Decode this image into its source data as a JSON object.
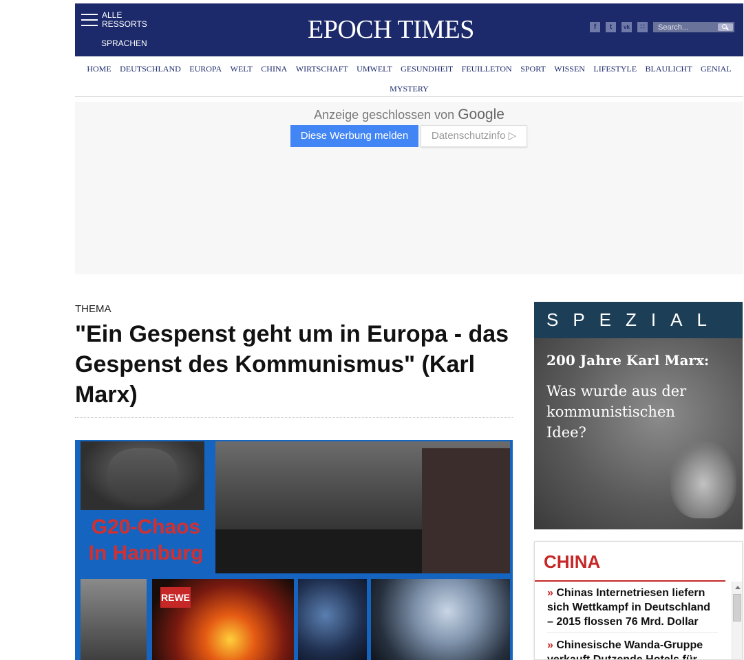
{
  "header": {
    "menu_label_line1": "ALLE",
    "menu_label_line2": "RESSORTS",
    "languages_label": "SPRACHEN",
    "logo": "EPOCH TIMES",
    "search_placeholder": "Search...",
    "social": [
      {
        "icon": "facebook-icon",
        "glyph": "f"
      },
      {
        "icon": "twitter-icon",
        "glyph": "t"
      },
      {
        "icon": "vk-icon",
        "glyph": "vk"
      },
      {
        "icon": "rss-icon",
        "glyph": "∷"
      }
    ],
    "brand_color": "#1c2a6b"
  },
  "nav": {
    "items": [
      "HOME",
      "DEUTSCHLAND",
      "EUROPA",
      "WELT",
      "CHINA",
      "WIRTSCHAFT",
      "UMWELT",
      "GESUNDHEIT",
      "FEUILLETON",
      "SPORT",
      "WISSEN",
      "LIFESTYLE",
      "BLAULICHT",
      "GENIAL",
      "MYSTERY"
    ]
  },
  "ad": {
    "closed_text": "Anzeige geschlossen von",
    "closed_brand": "Google",
    "report_button": "Diese Werbung melden",
    "privacy_button": "Datenschutzinfo ▷"
  },
  "article": {
    "kicker": "THEMA",
    "headline": "\"Ein Gespenst geht um in Europa - das Gespenst des Kommunismus\" (Karl Marx)",
    "image_caption_line1": "G20-Chaos",
    "image_caption_line2": "In Hamburg",
    "store_sign": "REWE"
  },
  "sidebar": {
    "spezial": {
      "heading": "SPEZIAL",
      "title": "200 Jahre Karl Marx:",
      "subtitle": "Was wurde aus der kommunistischen Idee?"
    },
    "china": {
      "heading": "CHINA",
      "items": [
        "Chinas Internetriesen liefern sich Wettkampf in Deutschland – 2015 flossen 76 Mrd. Dollar",
        "Chinesische Wanda-Gruppe verkauft Dutzende Hotels für"
      ],
      "accent": "#c62828"
    }
  }
}
